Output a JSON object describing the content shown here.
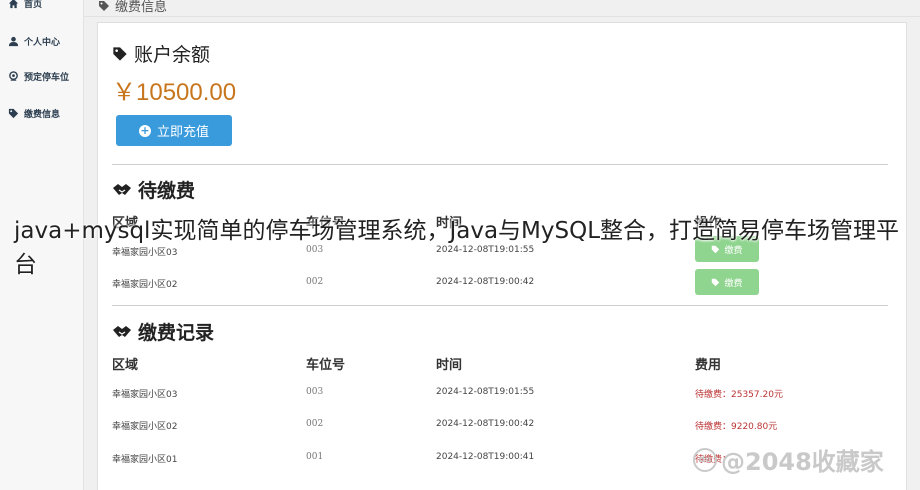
{
  "sidebar": {
    "items": [
      {
        "label": "首页",
        "icon": "home-icon"
      },
      {
        "label": "个人中心",
        "icon": "user-icon"
      },
      {
        "label": "预定停车位",
        "icon": "location-icon"
      },
      {
        "label": "缴费信息",
        "icon": "tag-icon"
      }
    ]
  },
  "breadcrumb": {
    "label": "缴费信息",
    "icon": "tag-icon"
  },
  "balance": {
    "title": "账户余额",
    "amount": "￥10500.00",
    "recharge_label": "立即充值"
  },
  "pending": {
    "title": "待缴费",
    "headers": {
      "area": "区域",
      "slot": "车位号",
      "time": "时间",
      "action": "操作"
    },
    "rows": [
      {
        "area": "幸福家园小区03",
        "slot": "003",
        "time": "2024-12-08T19:01:55",
        "action": "缴费"
      },
      {
        "area": "幸福家园小区02",
        "slot": "002",
        "time": "2024-12-08T19:00:42",
        "action": "缴费"
      }
    ]
  },
  "records": {
    "title": "缴费记录",
    "headers": {
      "area": "区域",
      "slot": "车位号",
      "time": "时间",
      "fee": "费用"
    },
    "rows": [
      {
        "area": "幸福家园小区03",
        "slot": "003",
        "time": "2024-12-08T19:01:55",
        "fee": "待缴费：25357.20元"
      },
      {
        "area": "幸福家园小区02",
        "slot": "002",
        "time": "2024-12-08T19:00:42",
        "fee": "待缴费：9220.80元"
      },
      {
        "area": "幸福家园小区01",
        "slot": "001",
        "time": "2024-12-08T19:00:41",
        "fee": "待缴费："
      }
    ]
  },
  "overlay": {
    "caption": "java+mysql实现简单的停车场管理系统，Java与MySQL整合，打造简易停车场管理平台",
    "watermark": "@2048收藏家",
    "watermark_logo": "du"
  },
  "colors": {
    "accent": "#3a9bdc",
    "balance": "#c8761d",
    "pay_button": "#8fd48f",
    "fee_text": "#b33333"
  }
}
